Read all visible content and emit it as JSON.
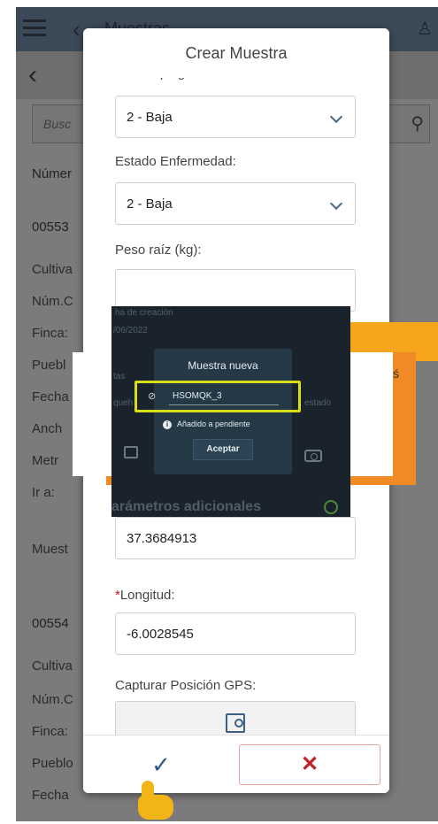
{
  "background_screen": {
    "title": "Muestras",
    "search_placeholder": "Busc",
    "column_header": "Númer",
    "records": [
      {
        "id": "00553",
        "labels": [
          "Cultiva",
          "Núm.C",
          "Finca:",
          "Puebl",
          "Fecha",
          "Anch",
          "Metr",
          "Ir a:"
        ],
        "section": "Muest"
      },
      {
        "id": "00554",
        "labels": [
          "Cultiva",
          "Núm.C",
          "Finca:",
          "Pueblo",
          "Fecha"
        ]
      }
    ]
  },
  "modal": {
    "title": "Crear Muestra",
    "fields": {
      "estado_plaga": {
        "label": "Estado plaga:",
        "value": "2 - Baja"
      },
      "estado_enfermedad": {
        "label": "Estado Enfermedad:",
        "value": "2 - Baja"
      },
      "peso_raiz": {
        "label": "Peso raíz (kg):",
        "value": ""
      },
      "latitud": {
        "value": "37.3684913"
      },
      "longitud": {
        "required_mark": "*",
        "label": "Longitud:",
        "value": "-6.0028545"
      },
      "gps": {
        "label": "Capturar Posición GPS:"
      }
    },
    "footer": {
      "ok_glyph": "✓",
      "cancel_glyph": "✕"
    }
  },
  "tutorial_overlay": {
    "side_hint": "ś",
    "phone_screenshot": {
      "dim_texts": {
        "fecha_creacion": "ha de creación",
        "fecha": "/06/2022",
        "tas": "tas",
        "pendiente": "queh",
        "estado": "estado"
      },
      "footer_text": "arámetros adicionales",
      "dialog": {
        "title": "Muestra nueva",
        "code_glyph": "⊘",
        "code": "HSOMQK_3",
        "info_text": "Añadido a pendiente",
        "accept_label": "Aceptar"
      }
    }
  },
  "colors": {
    "accent": "#2c5b86",
    "danger": "#c42024",
    "highlight": "#d9de1a",
    "orange": "#ef8a26",
    "yellow": "#f7a51c"
  }
}
